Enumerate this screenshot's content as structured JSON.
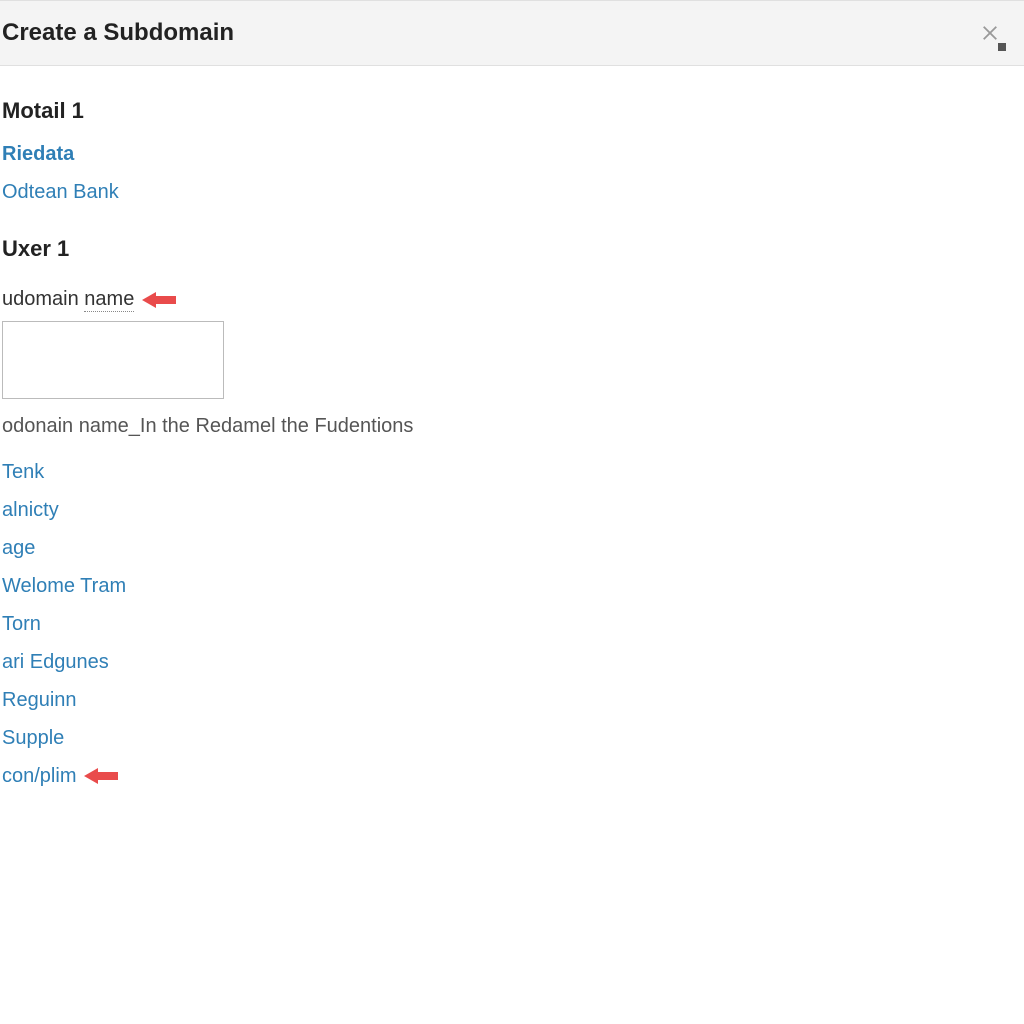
{
  "header": {
    "title": "Create a Subdomain"
  },
  "section1": {
    "title": "Motail 1",
    "links": [
      {
        "label": "Riedata",
        "bold": true
      },
      {
        "label": "Odtean Bank",
        "bold": false
      }
    ]
  },
  "section2": {
    "title": "Uxer 1",
    "field_label_prefix": "udomain ",
    "field_label_underlined": "name",
    "input_value": "",
    "helper_text": "odonain name_In the Redamel the Fudentions",
    "links": [
      "Tenk",
      "alnicty",
      "age",
      "Welome Tram",
      "Torn",
      "ari Edgunes",
      "Reguinn",
      "Supple",
      "con/plim"
    ]
  },
  "colors": {
    "link": "#2f7fb6",
    "arrow": "#e94b4b"
  }
}
